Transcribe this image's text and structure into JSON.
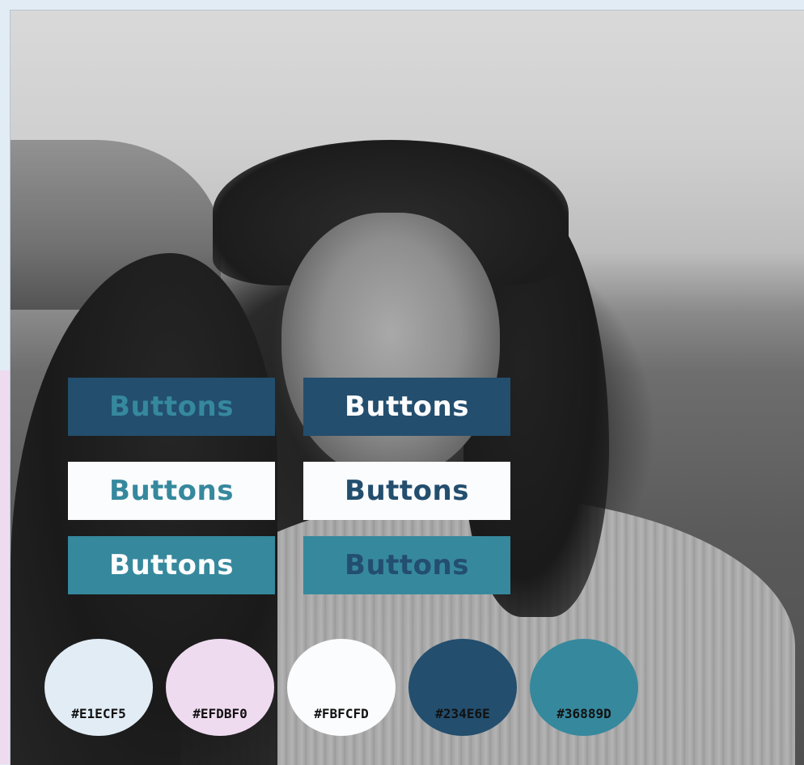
{
  "buttons": [
    {
      "label": "Buttons",
      "background": "#234E6E",
      "text_color": "#36889D"
    },
    {
      "label": "Buttons",
      "background": "#234E6E",
      "text_color": "#FBFCFD"
    },
    {
      "label": "Buttons",
      "background": "#FBFCFD",
      "text_color": "#36889D"
    },
    {
      "label": "Buttons",
      "background": "#FBFCFD",
      "text_color": "#234E6E"
    },
    {
      "label": "Buttons",
      "background": "#36889D",
      "text_color": "#FBFCFD"
    },
    {
      "label": "Buttons",
      "background": "#36889D",
      "text_color": "#234E6E"
    }
  ],
  "palette": [
    {
      "hex": "#E1ECF5",
      "color": "#E1ECF5"
    },
    {
      "hex": "#EFDBF0",
      "color": "#EFDBF0"
    },
    {
      "hex": "#FBFCFD",
      "color": "#FBFCFD"
    },
    {
      "hex": "#234E6E",
      "color": "#234E6E"
    },
    {
      "hex": "#36889D",
      "color": "#36889D"
    }
  ]
}
